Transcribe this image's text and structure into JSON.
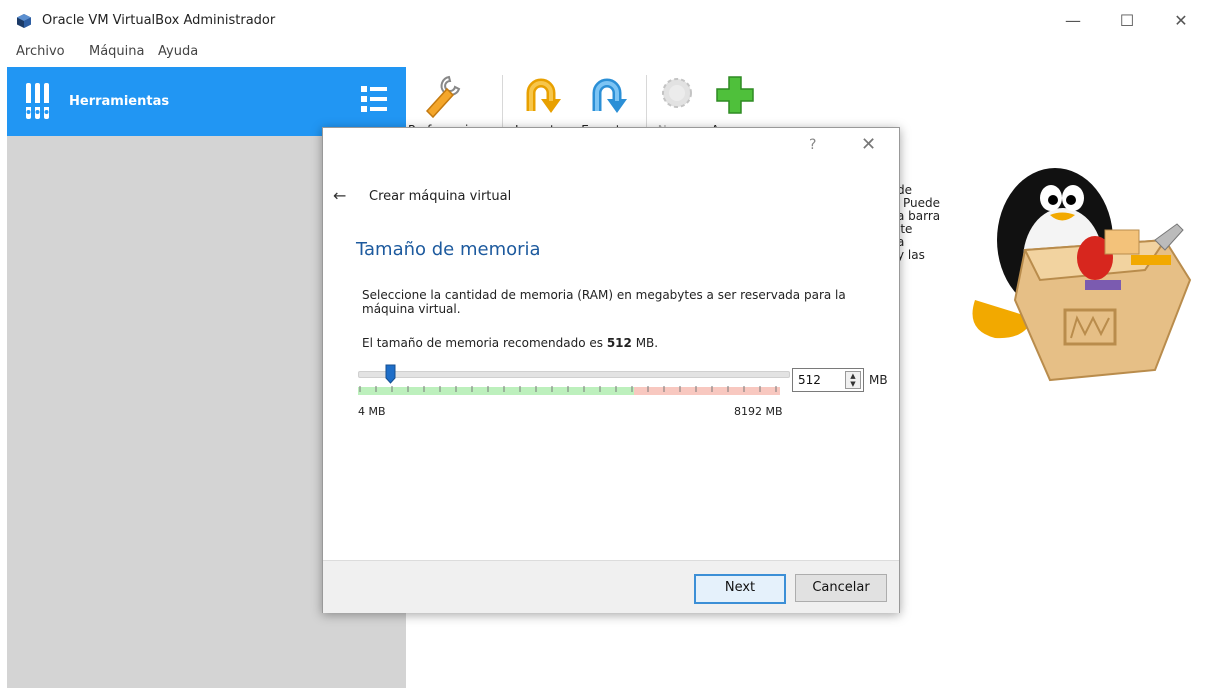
{
  "window": {
    "title": "Oracle VM VirtualBox Administrador"
  },
  "menu": [
    "Archivo",
    "Máquina",
    "Ayuda"
  ],
  "sidebar": {
    "tools_label": "Herramientas"
  },
  "toolbar": {
    "preferences": "Preferencias",
    "import": "Importar",
    "export": "Exportar",
    "new": "Nueva",
    "add": "Agregar"
  },
  "background_text": [
    "de",
    "Puede",
    "a barra",
    "ite",
    "a",
    "y las"
  ],
  "dialog": {
    "help": "?",
    "close": "✕",
    "header": "Crear máquina virtual",
    "title": "Tamaño de memoria",
    "description": "Seleccione la cantidad de memoria (RAM) en megabytes a ser reservada para la máquina virtual.",
    "recommended_prefix": "El tamaño de memoria recomendado es ",
    "recommended_value": "512",
    "recommended_suffix": " MB.",
    "slider": {
      "value_mb": 512,
      "min_label": "4 MB",
      "max_label": "8192 MB"
    },
    "spin_value": "512",
    "unit": "MB",
    "next_label": "Next",
    "cancel_label": "Cancelar"
  },
  "colors": {
    "accent": "#2196f3",
    "title_blue": "#1d5a9e",
    "safe_zone": "#bdf0bd",
    "warn_zone": "#f8c8c0"
  }
}
